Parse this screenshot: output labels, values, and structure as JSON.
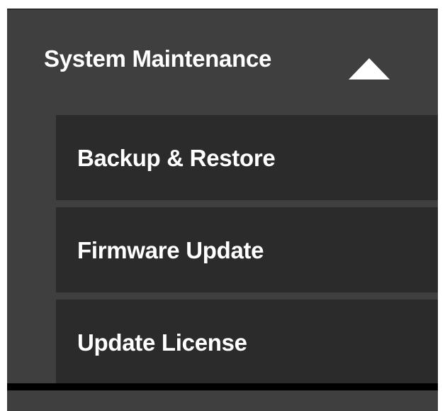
{
  "menu": {
    "section_title": "System Maintenance",
    "expanded": true,
    "toggle_icon": "chevron-up-icon",
    "items": [
      {
        "label": "Backup & Restore"
      },
      {
        "label": "Firmware Update"
      },
      {
        "label": "Update License"
      }
    ]
  },
  "colors": {
    "panel_background": "#3f3f3f",
    "item_background": "#2b2b2b",
    "text": "#ffffff",
    "divider": "#000000"
  }
}
